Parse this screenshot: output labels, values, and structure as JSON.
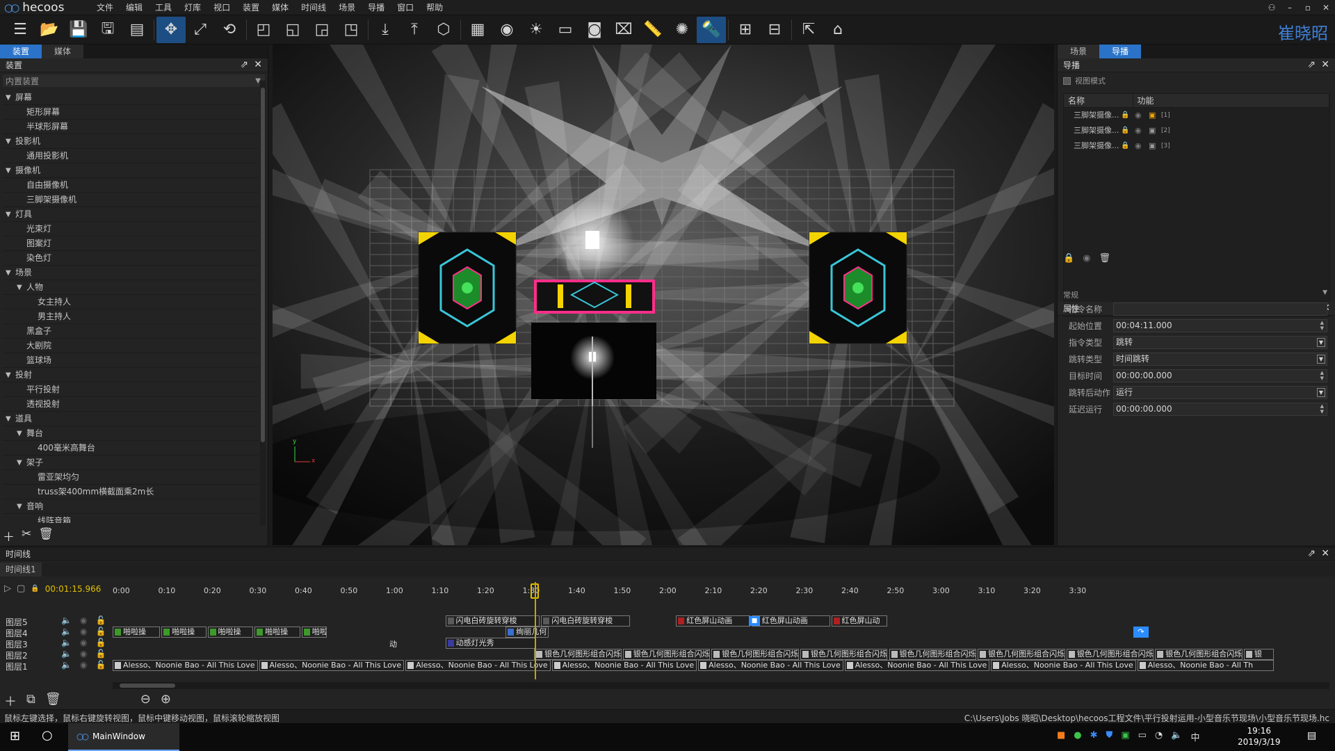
{
  "app": {
    "name": "hecoos",
    "brand": "崔晓昭"
  },
  "menu": [
    "文件",
    "编辑",
    "工具",
    "灯库",
    "视口",
    "装置",
    "媒体",
    "时间线",
    "场景",
    "导播",
    "窗口",
    "帮助"
  ],
  "window_controls": {
    "user": "⚇",
    "minimize": "–",
    "restore": "▫",
    "close": "✕"
  },
  "toolbar_icons": [
    "scene-list",
    "open",
    "save",
    "save-as",
    "library",
    "move",
    "scale",
    "rotate",
    "align-a",
    "align-b",
    "align-c",
    "align-d",
    "drop",
    "lift",
    "cube",
    "grid",
    "eye",
    "light",
    "fps",
    "camera",
    "screenshot",
    "ruler",
    "sun",
    "spotlight",
    "layout-a",
    "layout-b",
    "export",
    "home"
  ],
  "left_panel": {
    "tabs": [
      "装置",
      "媒体"
    ],
    "header": "装置",
    "category": "内置装置",
    "tree": [
      {
        "label": "屏幕",
        "level": 0,
        "expanded": true
      },
      {
        "label": "矩形屏幕",
        "level": 1
      },
      {
        "label": "半球形屏幕",
        "level": 1
      },
      {
        "label": "投影机",
        "level": 0,
        "expanded": true
      },
      {
        "label": "通用投影机",
        "level": 1
      },
      {
        "label": "摄像机",
        "level": 0,
        "expanded": true
      },
      {
        "label": "自由摄像机",
        "level": 1
      },
      {
        "label": "三脚架摄像机",
        "level": 1
      },
      {
        "label": "灯具",
        "level": 0,
        "expanded": true
      },
      {
        "label": "光束灯",
        "level": 1
      },
      {
        "label": "图案灯",
        "level": 1
      },
      {
        "label": "染色灯",
        "level": 1
      },
      {
        "label": "场景",
        "level": 0,
        "expanded": true
      },
      {
        "label": "人物",
        "level": 1,
        "expanded": true
      },
      {
        "label": "女主持人",
        "level": 2
      },
      {
        "label": "男主持人",
        "level": 2
      },
      {
        "label": "黑盒子",
        "level": 1
      },
      {
        "label": "大剧院",
        "level": 1
      },
      {
        "label": "篮球场",
        "level": 1
      },
      {
        "label": "投射",
        "level": 0,
        "expanded": true
      },
      {
        "label": "平行投射",
        "level": 1
      },
      {
        "label": "透视投射",
        "level": 1
      },
      {
        "label": "道具",
        "level": 0,
        "expanded": true
      },
      {
        "label": "舞台",
        "level": 1,
        "expanded": true
      },
      {
        "label": "400毫米高舞台",
        "level": 2
      },
      {
        "label": "架子",
        "level": 1,
        "expanded": true
      },
      {
        "label": "雷亚架均匀",
        "level": 2
      },
      {
        "label": "truss架400mm横截面乘2m长",
        "level": 2
      },
      {
        "label": "音响",
        "level": 1,
        "expanded": true
      },
      {
        "label": "线阵音箱",
        "level": 2
      }
    ]
  },
  "viewport": {
    "axis_x": "x",
    "axis_y": "y"
  },
  "right_panel": {
    "tabs": [
      "场景",
      "导播"
    ],
    "nav_header": "导播",
    "view_mode_label": "视图模式",
    "table_headers": [
      "名称",
      "功能"
    ],
    "cameras": [
      {
        "name": "三脚架摄像...",
        "index": "[1]",
        "active": true
      },
      {
        "name": "三脚架摄像...",
        "index": "[2]",
        "active": false
      },
      {
        "name": "三脚架摄像...",
        "index": "[3]",
        "active": false
      }
    ],
    "props_header": "属性",
    "props_group": "常规",
    "properties": [
      {
        "label": "指令名称",
        "value": "",
        "kind": "text"
      },
      {
        "label": "起始位置",
        "value": "00:04:11.000",
        "kind": "spin"
      },
      {
        "label": "指令类型",
        "value": "跳转",
        "kind": "select"
      },
      {
        "label": "跳转类型",
        "value": "时间跳转",
        "kind": "select"
      },
      {
        "label": "目标时间",
        "value": "00:00:00.000",
        "kind": "spin"
      },
      {
        "label": "跳转后动作",
        "value": "运行",
        "kind": "select"
      },
      {
        "label": "延迟运行",
        "value": "00:00:00.000",
        "kind": "spin"
      }
    ]
  },
  "timeline": {
    "header": "时间线",
    "tab": "时间线1",
    "current_time": "00:01:15.966",
    "ticks": [
      "0:00",
      "0:10",
      "0:20",
      "0:30",
      "0:40",
      "0:50",
      "1:00",
      "1:10",
      "1:20",
      "1:30",
      "1:40",
      "1:50",
      "2:00",
      "2:10",
      "2:20",
      "2:30",
      "2:40",
      "2:50",
      "3:00",
      "3:10",
      "3:20",
      "3:30"
    ],
    "layers": [
      {
        "name": "图层5",
        "clips": [
          {
            "label": "闪电白砖旋转穿梭",
            "start": 0.375,
            "end": 0.483,
            "color": "#5a5a5a"
          },
          {
            "label": "闪电白砖旋转穿梭",
            "start": 0.483,
            "end": 0.585,
            "color": "#5a5a5a"
          },
          {
            "label": "红色屏山动画",
            "start": 0.635,
            "end": 0.72,
            "color": "#b02020"
          },
          {
            "label": "红色屏山动画",
            "start": 0.72,
            "end": 0.81,
            "color": "#b02020"
          },
          {
            "label": "红色屏山动",
            "start": 0.81,
            "end": 0.875,
            "color": "#b02020"
          }
        ]
      },
      {
        "name": "图层4",
        "clips": [
          {
            "label": "啪啦操",
            "start": 0.0,
            "end": 0.055,
            "color": "#3d9a2a"
          },
          {
            "label": "啪啦操",
            "start": 0.055,
            "end": 0.107,
            "color": "#3d9a2a"
          },
          {
            "label": "啪啦操",
            "start": 0.107,
            "end": 0.16,
            "color": "#3d9a2a"
          },
          {
            "label": "啪啦操",
            "start": 0.16,
            "end": 0.213,
            "color": "#3d9a2a"
          },
          {
            "label": "啪啦",
            "start": 0.213,
            "end": 0.243,
            "color": "#3d9a2a"
          },
          {
            "label": "绚丽几何",
            "start": 0.443,
            "end": 0.493,
            "color": "#3a6fd0"
          }
        ]
      },
      {
        "name": "图层3",
        "clips": [
          {
            "label": "动感灯光秀",
            "start": 0.375,
            "end": 0.478,
            "color": "#3a3aa0"
          }
        ]
      },
      {
        "name": "图层2",
        "clips": [
          {
            "label": "银色几何图形组合闪烁",
            "start": 0.475,
            "end": 0.575,
            "color": "#bbbbbb"
          },
          {
            "label": "银色几何图形组合闪烁",
            "start": 0.575,
            "end": 0.675,
            "color": "#bbbbbb"
          },
          {
            "label": "银色几何图形组合闪烁",
            "start": 0.675,
            "end": 0.775,
            "color": "#bbbbbb"
          },
          {
            "label": "银色几何图形组合闪烁",
            "start": 0.775,
            "end": 0.875,
            "color": "#bbbbbb"
          },
          {
            "label": "银色几何图形组合闪烁",
            "start": 0.875,
            "end": 0.975,
            "color": "#bbbbbb"
          },
          {
            "label": "银色几何图形组合闪烁",
            "start": 0.975,
            "end": 1.075,
            "color": "#bbbbbb"
          },
          {
            "label": "银色几何图形组合闪烁",
            "start": 1.075,
            "end": 1.175,
            "color": "#bbbbbb"
          },
          {
            "label": "银色几何图形组合闪烁",
            "start": 1.175,
            "end": 1.275,
            "color": "#bbbbbb"
          },
          {
            "label": "银",
            "start": 1.275,
            "end": 1.31,
            "color": "#bbbbbb"
          }
        ]
      },
      {
        "name": "图层1",
        "clips": [
          {
            "label": "Alesso、Noonie Bao - All This Love",
            "start": 0.0,
            "end": 0.165,
            "color": "#cccccc"
          },
          {
            "label": "Alesso、Noonie Bao - All This Love",
            "start": 0.165,
            "end": 0.33,
            "color": "#cccccc"
          },
          {
            "label": "Alesso、Noonie Bao - All This Love",
            "start": 0.33,
            "end": 0.495,
            "color": "#cccccc"
          },
          {
            "label": "Alesso、Noonie Bao - All This Love",
            "start": 0.495,
            "end": 0.66,
            "color": "#cccccc"
          },
          {
            "label": "Alesso、Noonie Bao - All This Love",
            "start": 0.66,
            "end": 0.825,
            "color": "#cccccc"
          },
          {
            "label": "Alesso、Noonie Bao - All This Love",
            "start": 0.825,
            "end": 0.99,
            "color": "#cccccc"
          },
          {
            "label": "Alesso、Noonie Bao - All This Love",
            "start": 0.99,
            "end": 1.155,
            "color": "#cccccc"
          },
          {
            "label": "Alesso、Noonie Bao - All Th",
            "start": 1.155,
            "end": 1.31,
            "color": "#cccccc"
          }
        ]
      }
    ],
    "clip_text_layer4_extra": "动"
  },
  "status_bar": {
    "hint": "鼠标左键选择，鼠标右键旋转视图，鼠标中键移动视图，鼠标滚轮缩放视图",
    "path": "C:\\Users\\Jobs 晓昭\\Desktop\\hecoos工程文件\\平行投射运用-小型音乐节现场\\小型音乐节现场.hc"
  },
  "taskbar": {
    "window_title": "MainWindow",
    "time": "19:16",
    "date": "2019/3/19",
    "ime": "中"
  },
  "colors": {
    "accent": "#2a73c8",
    "playhead": "#e2c000",
    "active_tool": "#1d4e83"
  }
}
